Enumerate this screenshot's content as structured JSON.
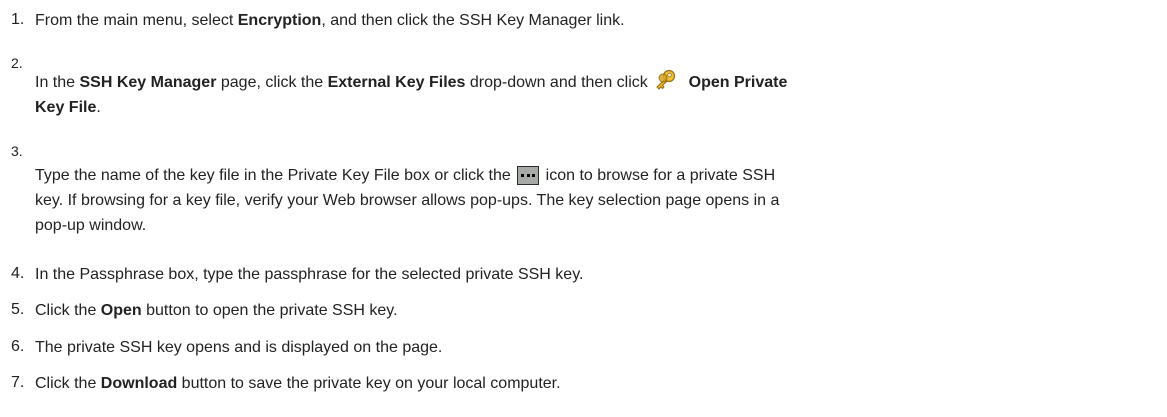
{
  "steps": [
    {
      "number": "1.",
      "parts": {
        "a": "From the main menu, select ",
        "b": "Encryption",
        "c": ", and then click the SSH Key Manager link."
      }
    },
    {
      "number": "2.",
      "parts": {
        "a": "In the ",
        "b": "SSH Key Manager",
        "c": " page, click the ",
        "d": "External Key Files",
        "e": " drop-down and then click ",
        "icon": "key-icon",
        "f": " Open Private",
        "g": "Key File",
        "h": "."
      }
    },
    {
      "number": "3.",
      "parts": {
        "a": "Type the name of the key file in the Private Key File box or click the ",
        "icon": "browse-icon",
        "b": " icon to browse for a private SSH",
        "c": "key. If browsing for a key file, verify your Web browser allows pop-ups. The key selection page opens in a",
        "d": "pop-up window."
      }
    },
    {
      "number": "4.",
      "parts": {
        "a": "In the Passphrase box, type the passphrase for the selected private SSH key."
      }
    },
    {
      "number": "5.",
      "parts": {
        "a": "Click the ",
        "b": "Open",
        "c": " button to open the private SSH key."
      }
    },
    {
      "number": "6.",
      "parts": {
        "a": "The private SSH key opens and is displayed on the page."
      }
    },
    {
      "number": "7.",
      "parts": {
        "a": "Click the ",
        "b": "Download",
        "c": " button to save the private key on your local computer."
      }
    }
  ]
}
